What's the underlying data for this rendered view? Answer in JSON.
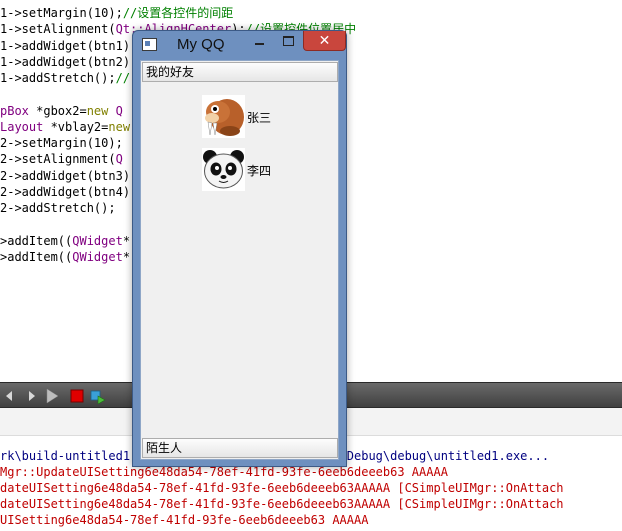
{
  "editor": {
    "lines": [
      [
        {
          "t": "1->setMargin(10);",
          "c": ""
        },
        {
          "t": "//设置各控件的间距",
          "c": "cm"
        }
      ],
      [
        {
          "t": "1->setAlignment(",
          "c": ""
        },
        {
          "t": "Qt::AlignHCenter",
          "c": "ty"
        },
        {
          "t": ");",
          "c": ""
        },
        {
          "t": "//设置控件位置居中",
          "c": "cm"
        }
      ],
      [
        {
          "t": "1->addWidget(btn1);",
          "c": ""
        }
      ],
      [
        {
          "t": "1->addWidget(btn2);",
          "c": ""
        }
      ],
      [
        {
          "t": "1->addStretch();",
          "c": ""
        },
        {
          "t": "//",
          "c": "cm"
        }
      ],
      [],
      [
        {
          "t": "pBox",
          "c": "ty"
        },
        {
          "t": " *gbox2=",
          "c": ""
        },
        {
          "t": "new",
          "c": "kw"
        },
        {
          "t": " Q",
          "c": "ty"
        }
      ],
      [
        {
          "t": "Layout",
          "c": "ty"
        },
        {
          "t": " *vblay2=",
          "c": ""
        },
        {
          "t": "new",
          "c": "kw"
        }
      ],
      [
        {
          "t": "2->setMargin(10);",
          "c": ""
        }
      ],
      [
        {
          "t": "2->setAlignment(",
          "c": ""
        },
        {
          "t": "Q",
          "c": "ty"
        },
        {
          "t": "                          ",
          "c": ""
        },
        {
          "t": "置居中",
          "c": "cm"
        }
      ],
      [
        {
          "t": "2->addWidget(btn3);",
          "c": ""
        }
      ],
      [
        {
          "t": "2->addWidget(btn4);",
          "c": ""
        }
      ],
      [
        {
          "t": "2->addStretch();",
          "c": ""
        }
      ],
      [],
      [
        {
          "t": ">addItem((",
          "c": ""
        },
        {
          "t": "QWidget",
          "c": "ty"
        },
        {
          "t": "*)gbox1,",
          "c": ""
        }
      ],
      [
        {
          "t": ">addItem((",
          "c": ""
        },
        {
          "t": "QWidget",
          "c": "ty"
        },
        {
          "t": "*)gbox2,",
          "c": ""
        }
      ]
    ]
  },
  "output": {
    "lines": [
      {
        "t": "rk\\build-untitled1-Desktop_Qt_5_4_0_MinGW_32bit-Debug\\debug\\untitled1.exe...",
        "c": "blue"
      },
      {
        "t": "Mgr::UpdateUISetting6e48da54-78ef-41fd-93fe-6eeb6deeeb63 AAAAA",
        "c": "red"
      },
      {
        "t": "dateUISetting6e48da54-78ef-41fd-93fe-6eeb6deeeb63AAAAA [CSimpleUIMgr::OnAttach",
        "c": "red"
      },
      {
        "t": "dateUISetting6e48da54-78ef-41fd-93fe-6eeb6deeeb63AAAAA [CSimpleUIMgr::OnAttach",
        "c": "red"
      },
      {
        "t": "UISetting6e48da54-78ef-41fd-93fe-6eeb6deeeb63 AAAAA",
        "c": "red"
      }
    ]
  },
  "qq_window": {
    "title": "My QQ",
    "close_glyph": "✕",
    "group_friends": "我的好友",
    "group_strangers": "陌生人",
    "friends": [
      {
        "name": "张三",
        "avatar": "walrus-avatar-icon"
      },
      {
        "name": "李四",
        "avatar": "panda-avatar-icon"
      }
    ]
  }
}
